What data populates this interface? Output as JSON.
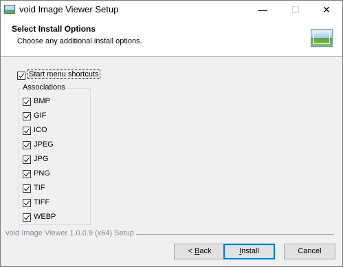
{
  "window": {
    "title": "void Image Viewer Setup",
    "minimize_glyph": "—",
    "maximize_glyph": "☐",
    "close_glyph": "✕"
  },
  "header": {
    "title": "Select Install Options",
    "subtitle": "Choose any additional install options.",
    "image_icon": "landscape-image-icon"
  },
  "options": {
    "start_menu": {
      "label": "Start menu shortcuts",
      "checked": true
    }
  },
  "associations": {
    "title": "Associations",
    "items": [
      {
        "label": "BMP",
        "checked": true
      },
      {
        "label": "GIF",
        "checked": true
      },
      {
        "label": "ICO",
        "checked": true
      },
      {
        "label": "JPEG",
        "checked": true
      },
      {
        "label": "JPG",
        "checked": true
      },
      {
        "label": "PNG",
        "checked": true
      },
      {
        "label": "TIF",
        "checked": true
      },
      {
        "label": "TIFF",
        "checked": true
      },
      {
        "label": "WEBP",
        "checked": true
      }
    ]
  },
  "footer": {
    "brand": "void Image Viewer 1.0.0.9 (x64) Setup"
  },
  "buttons": {
    "back_prefix": "< ",
    "back_mnemonic": "B",
    "back_rest": "ack",
    "install_mnemonic": "I",
    "install_rest": "nstall",
    "cancel": "Cancel"
  }
}
